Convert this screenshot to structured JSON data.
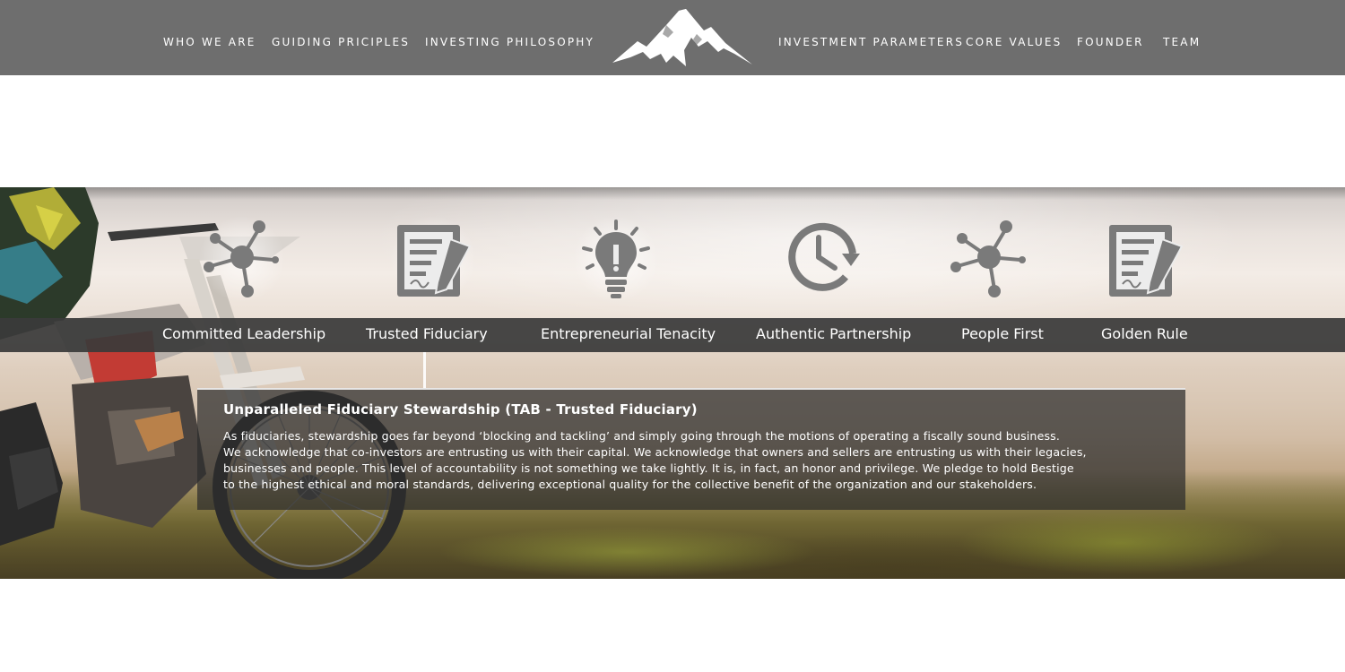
{
  "header": {
    "nav_left": [
      "WHO WE ARE",
      "GUIDING PRICIPLES",
      "INVESTING PHILOSOPHY"
    ],
    "nav_right": [
      "INVESTMENT PARAMETERS",
      "CORE VALUES",
      "FOUNDER",
      "TEAM"
    ],
    "logo_icon": "mountain-logo-icon",
    "background_color": "#6e6e6e"
  },
  "values": {
    "icons": [
      "network-icon",
      "document-edit-icon",
      "lightbulb-icon",
      "clock-refresh-icon",
      "network-icon",
      "document-edit-icon"
    ],
    "tabs": [
      "Committed Leadership",
      "Trusted Fiduciary",
      "Entrepreneurial Tenacity",
      "Authentic Partnership",
      "People First",
      "Golden Rule"
    ],
    "active_index": 1,
    "icon_color": "#7a7a7a",
    "bar_color": "#3a3a3a"
  },
  "detail": {
    "title": "Unparalleled Fiduciary Stewardship (TAB - Trusted Fiduciary)",
    "body": "As fiduciaries, stewardship goes far beyond ‘blocking and tackling’ and simply going through the motions of operating a fiscally sound business.\nWe acknowledge that co-investors are entrusting us with their capital.  We acknowledge that owners and sellers are entrusting us with their legacies,\nbusinesses and people.  This level of accountability is not something we take lightly.  It is, in fact, an honor and privilege.  We pledge to hold Bestige\nto the highest ethical and moral standards, delivering exceptional quality for the collective benefit of the organization and our stakeholders."
  }
}
